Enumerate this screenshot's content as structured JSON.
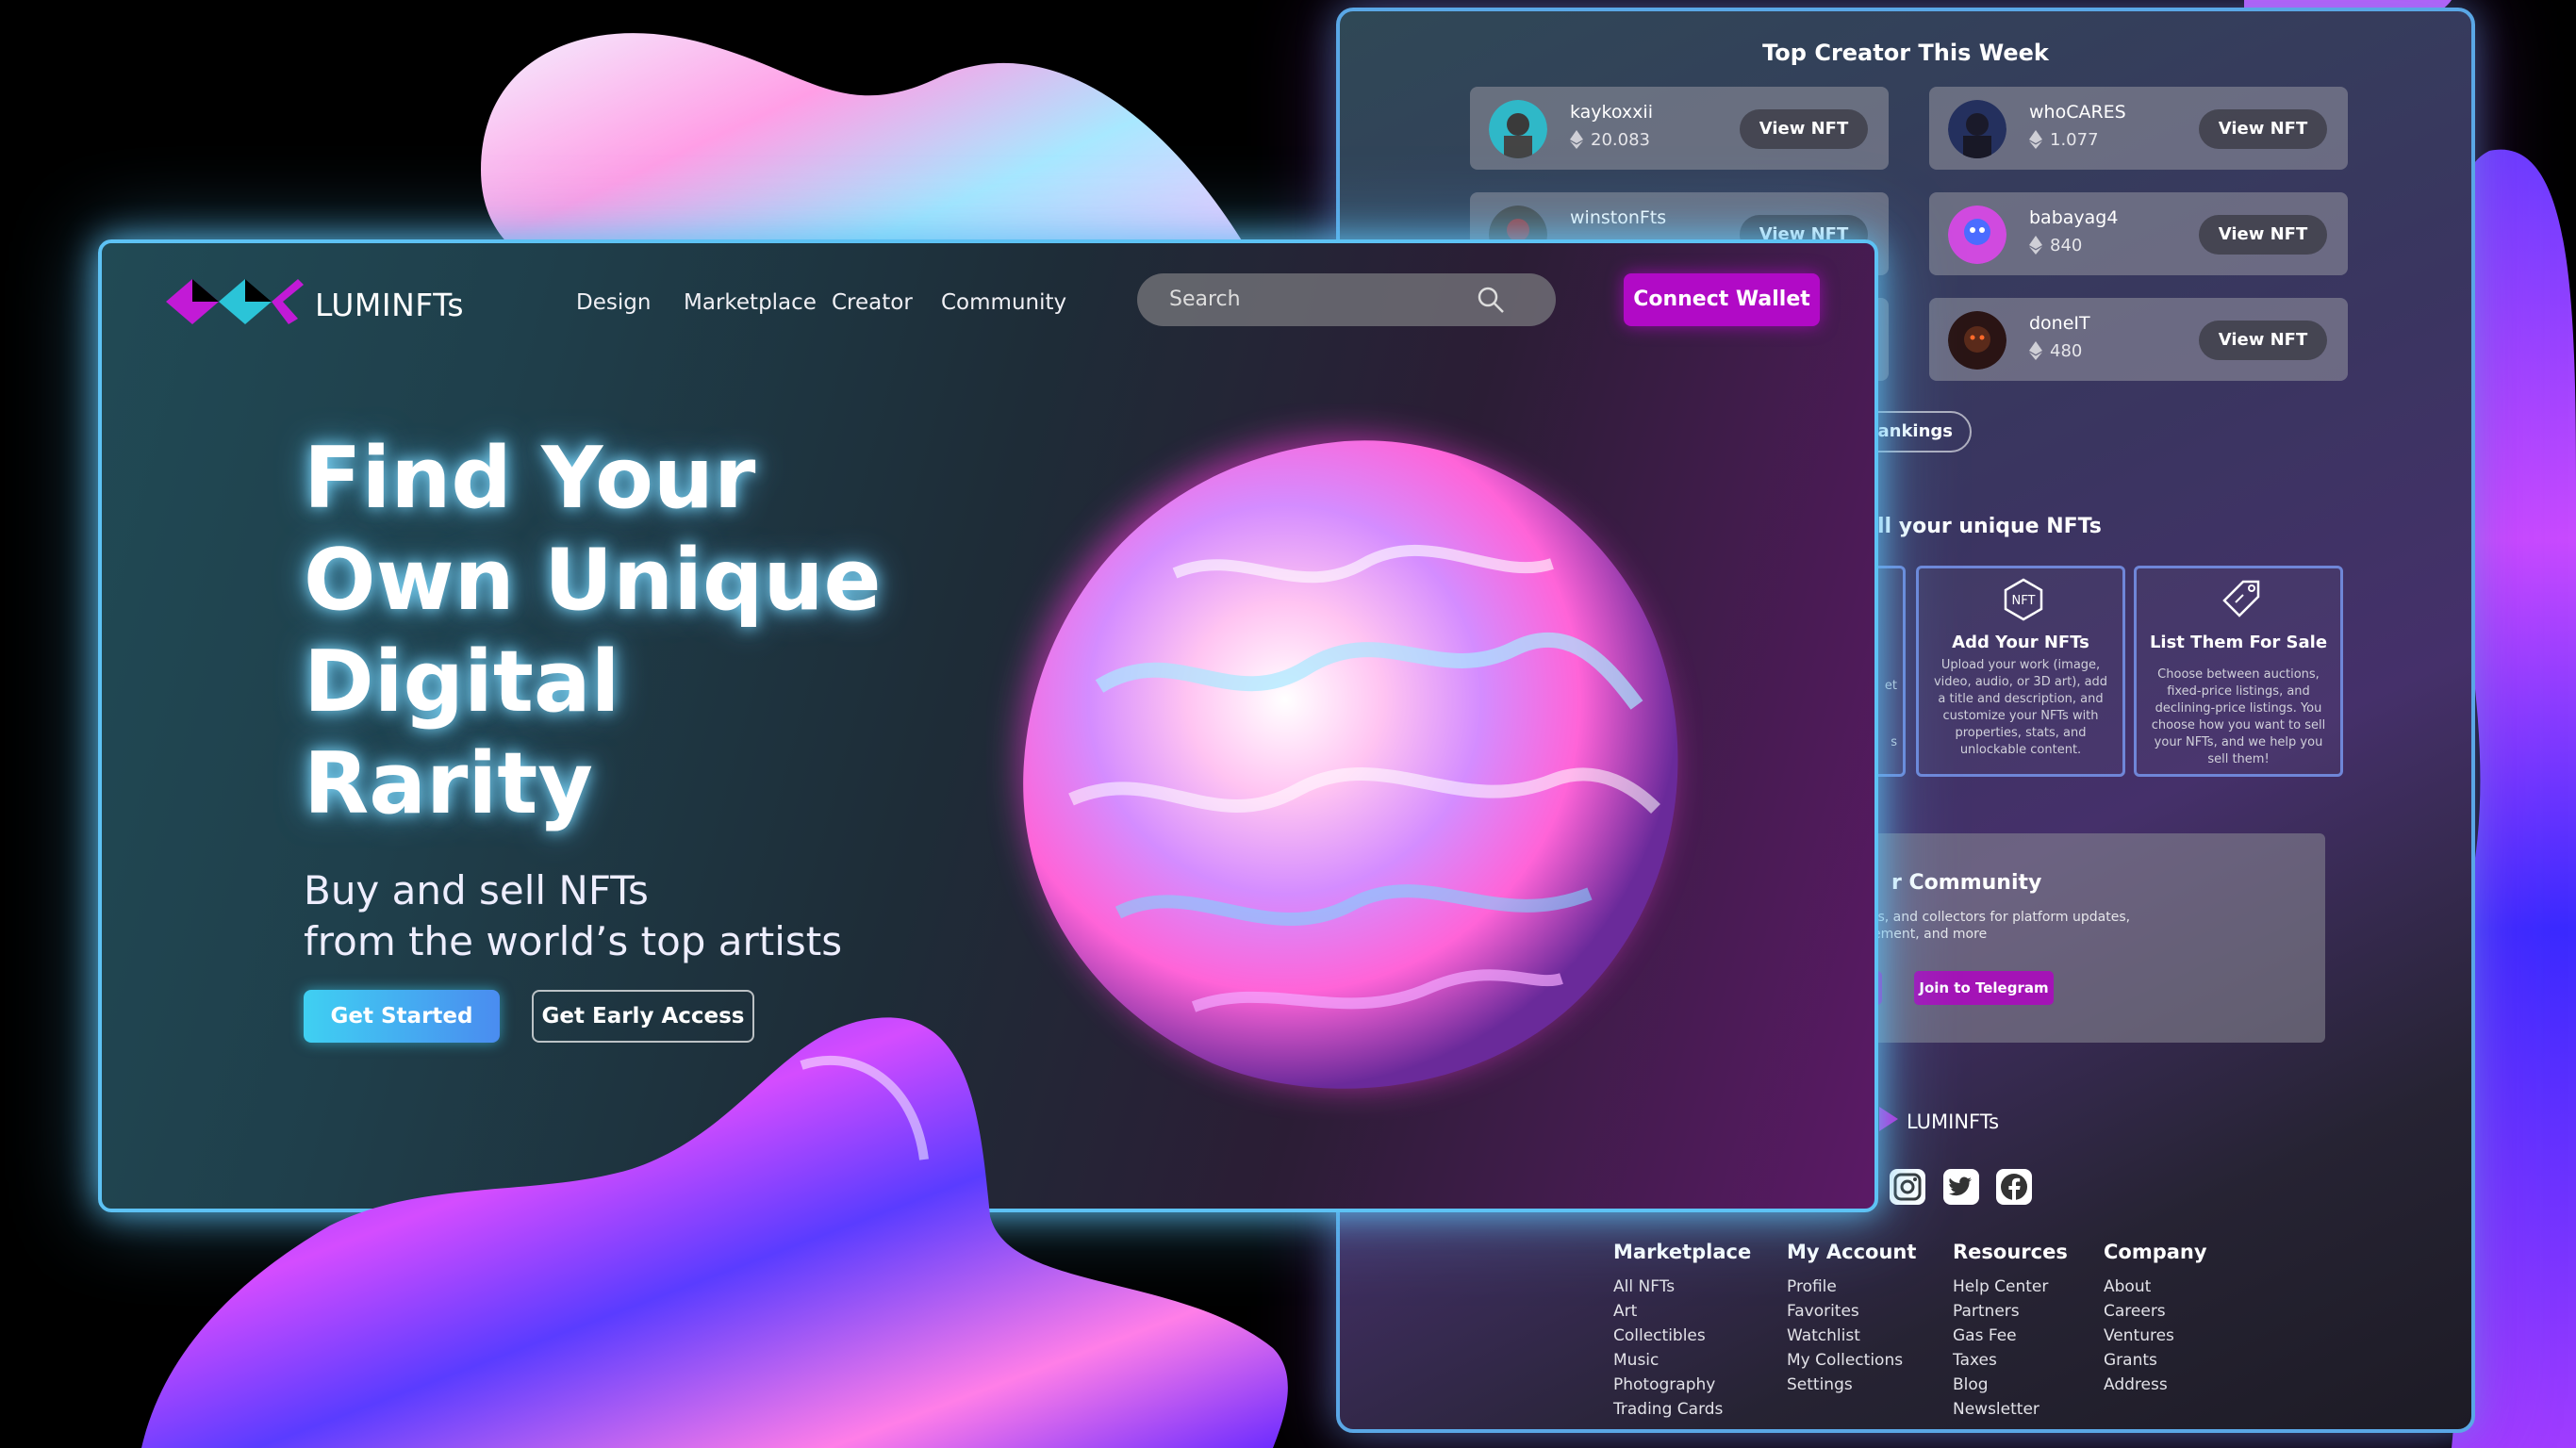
{
  "colors": {
    "accent": "#b10ac6",
    "cyan": "#5dc2f4",
    "button_gradient": [
      "#3fd0f2",
      "#4a8cf0"
    ]
  },
  "top_creators": {
    "title": "Top Creator This Week",
    "creators": [
      {
        "name": "kaykoxxii",
        "value": "20.083",
        "button": "View NFT"
      },
      {
        "name": "whoCARES",
        "value": "1.077",
        "button": "View NFT"
      },
      {
        "name": "winstonFts",
        "value": "",
        "button": "View NFT"
      },
      {
        "name": "babayag4",
        "value": "840",
        "button": "View NFT"
      },
      {
        "name": "doneIT",
        "value": "480",
        "button": "View NFT"
      }
    ],
    "rankings_button": "v Rankings"
  },
  "steps": {
    "title": "ll your unique NFTs",
    "items": [
      {
        "title": "Add Your NFTs",
        "desc": "Upload your work (image, video, audio, or 3D art), add a title and description, and customize your NFTs with properties, stats, and unlockable content.",
        "icon": "nft-hexagon-icon"
      },
      {
        "title": "List Them For Sale",
        "desc": "Choose between auctions, fixed-price listings, and declining-price listings. You choose how you want to sell your NFTs, and we help you sell them!",
        "icon": "price-tag-icon"
      }
    ],
    "partial_fragments": [
      "et",
      "s"
    ]
  },
  "community": {
    "title": "r Community",
    "desc": "ts, and collectors for platform updates, ement, and more",
    "telegram_button": "Join to Telegram"
  },
  "footer": {
    "brand": "LUMINFTs",
    "social": [
      "instagram-icon",
      "twitter-icon",
      "facebook-icon"
    ],
    "columns": [
      {
        "title": "Marketplace",
        "items": [
          "All NFTs",
          "Art",
          "Collectibles",
          "Music",
          "Photography",
          "Trading Cards"
        ]
      },
      {
        "title": "My Account",
        "items": [
          "Profile",
          "Favorites",
          "Watchlist",
          "My Collections",
          "Settings"
        ]
      },
      {
        "title": "Resources",
        "items": [
          "Help Center",
          "Partners",
          "Gas Fee",
          "Taxes",
          "Blog",
          "Newsletter"
        ]
      },
      {
        "title": "Company",
        "items": [
          "About",
          "Careers",
          "Ventures",
          "Grants",
          "Address"
        ]
      }
    ]
  },
  "header": {
    "brand": "LUMINFTs",
    "nav": [
      "Design",
      "Marketplace",
      "Creator",
      "Community"
    ],
    "search_placeholder": "Search",
    "wallet_button": "Connect Wallet"
  },
  "hero": {
    "title_lines": [
      "Find Your",
      "Own Unique",
      "Digital",
      "Rarity"
    ],
    "subtitle_lines": [
      "Buy and sell NFTs",
      "from the world’s top artists"
    ],
    "primary_button": "Get Started",
    "secondary_button": "Get Early Access"
  }
}
